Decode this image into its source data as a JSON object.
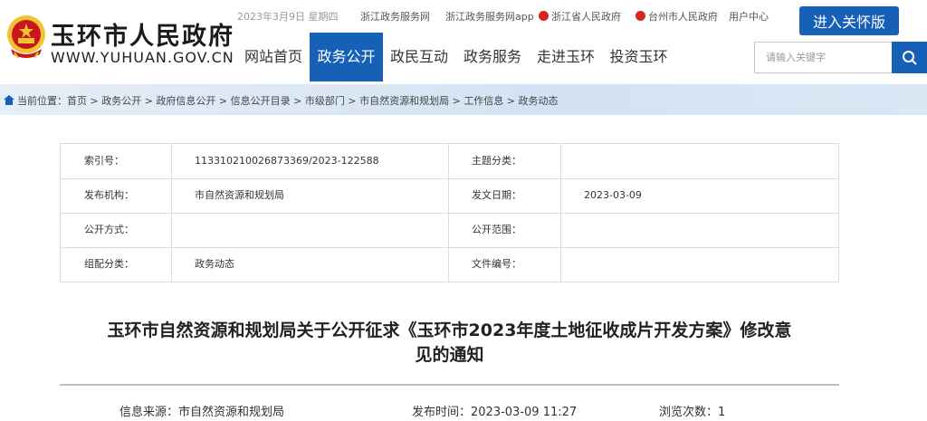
{
  "header": {
    "site_name": "玉环市人民政府",
    "site_domain": "WWW.YUHUAN.GOV.CN",
    "date": "2023年3月9日 星期四",
    "top_links": [
      "浙江政务服务网",
      "浙江政务服务网app",
      "浙江省人民政府",
      "台州市人民政府",
      "用户中心"
    ],
    "care_button": "进入关怀版"
  },
  "nav": {
    "items": [
      "网站首页",
      "政务公开",
      "政民互动",
      "政务服务",
      "走进玉环",
      "投资玉环"
    ],
    "active_index": 1
  },
  "search": {
    "placeholder": "请输入关键字"
  },
  "breadcrumb": {
    "label": "当前位置：",
    "items": [
      "首页",
      "政务公开",
      "政府信息公开",
      "信息公开目录",
      "市级部门",
      "市自然资源和规划局",
      "工作信息",
      "政务动态"
    ]
  },
  "meta": {
    "rows": [
      {
        "l_label": "索引号：",
        "l_value": "113310210026873369/2023-122588",
        "r_label": "主题分类：",
        "r_value": ""
      },
      {
        "l_label": "发布机构：",
        "l_value": "市自然资源和规划局",
        "r_label": "发文日期：",
        "r_value": "2023-03-09"
      },
      {
        "l_label": "公开方式：",
        "l_value": "",
        "r_label": "公开范围：",
        "r_value": ""
      },
      {
        "l_label": "组配分类：",
        "l_value": "政务动态",
        "r_label": "文件编号：",
        "r_value": ""
      }
    ]
  },
  "article": {
    "title_line1": "玉环市自然资源和规划局关于公开征求《玉环市2023年度土地征收成片开发方案》修改意",
    "title_line2": "见的通知",
    "source_label": "信息来源：",
    "source": "市自然资源和规划局",
    "publish_label": "发布时间：",
    "publish_time": "2023-03-09 11:27",
    "views_label": "浏览次数：",
    "views": "1"
  },
  "colors": {
    "primary": "#1660b8",
    "link_icon": "#d8261c",
    "emblem_red": "#c8161d",
    "emblem_gold": "#f2c230"
  },
  "icons": [
    "national-emblem-icon",
    "zhejiang-gov-icon",
    "taizhou-gov-icon",
    "home-icon",
    "search-icon"
  ]
}
